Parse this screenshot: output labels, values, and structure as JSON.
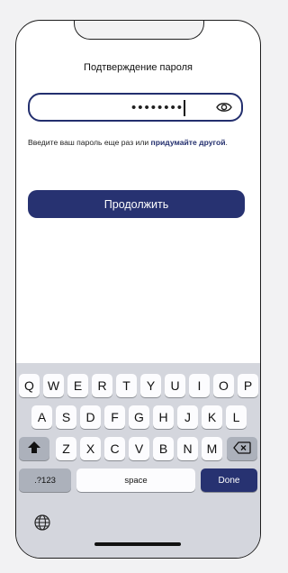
{
  "screen": {
    "title": "Подтверждение пароля",
    "password": {
      "masked_value": "••••••••",
      "visibility_icon": "eye-icon"
    },
    "hint": {
      "text_before": "Введите ваш пароль еще раз или ",
      "link": "придумайте другой",
      "text_after": "."
    },
    "continue_label": "Продолжить"
  },
  "keyboard": {
    "row1": [
      "Q",
      "W",
      "E",
      "R",
      "T",
      "Y",
      "U",
      "I",
      "O",
      "P"
    ],
    "row2": [
      "A",
      "S",
      "D",
      "F",
      "G",
      "H",
      "J",
      "K",
      "L"
    ],
    "row3": [
      "Z",
      "X",
      "C",
      "V",
      "B",
      "N",
      "M"
    ],
    "numbers_label": ".?123",
    "space_label": "space",
    "done_label": "Done",
    "shift_icon": "shift-icon",
    "backspace_icon": "backspace-icon",
    "globe_icon": "globe-icon"
  },
  "colors": {
    "accent": "#273271",
    "keyboard_bg": "#d4d6dd",
    "key_bg": "#fcfcfe",
    "key_dark": "#acb1bb"
  }
}
